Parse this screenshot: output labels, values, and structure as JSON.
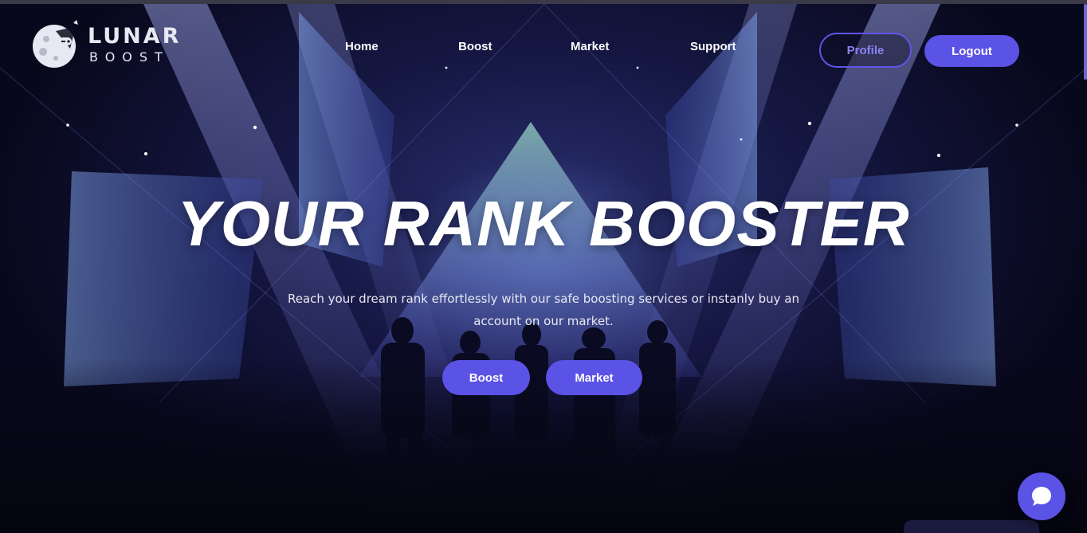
{
  "brand": {
    "name_line1": "LUNAR",
    "name_line2": "BOOST",
    "logo_icon": "moon-gamepad-icon"
  },
  "nav": {
    "items": [
      {
        "label": "Home"
      },
      {
        "label": "Boost"
      },
      {
        "label": "Market"
      },
      {
        "label": "Support"
      }
    ]
  },
  "header_actions": {
    "profile_label": "Profile",
    "logout_label": "Logout"
  },
  "hero": {
    "title": "YOUR RANK BOOSTER",
    "subtitle": "Reach your dream rank effortlessly with our safe boosting services or instanly buy an account on our market.",
    "boost_button": "Boost",
    "market_button": "Market"
  },
  "chat": {
    "icon": "chat-bubble-icon"
  },
  "colors": {
    "accent": "#5b52e6",
    "accent_outline": "#5f55e8",
    "background": "#0a0a1f",
    "text": "#ffffff"
  }
}
